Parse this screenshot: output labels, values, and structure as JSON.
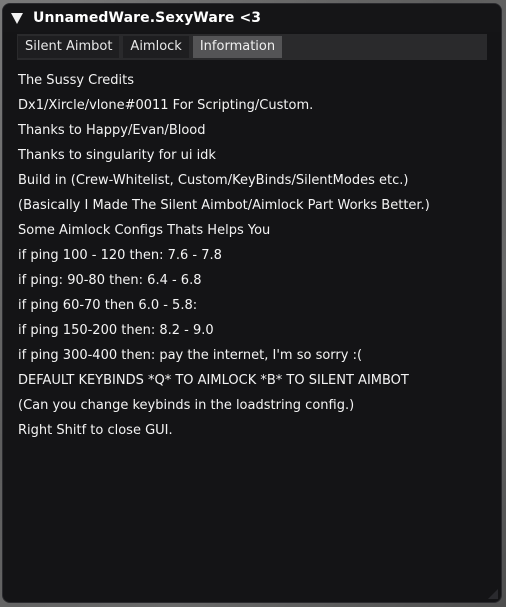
{
  "window": {
    "title": "UnnamedWare.SexyWare <3",
    "collapse_icon": "triangle-down-icon"
  },
  "tabs": [
    {
      "label": "Silent Aimbot",
      "active": false
    },
    {
      "label": "Aimlock",
      "active": false
    },
    {
      "label": "Information",
      "active": true
    }
  ],
  "info_lines": [
    "The Sussy Credits",
    "Dx1/Xircle/vlone#0011 For Scripting/Custom.",
    "Thanks to Happy/Evan/Blood",
    "Thanks to singularity for ui idk",
    "Build in (Crew-Whitelist, Custom/KeyBinds/SilentModes etc.)",
    "(Basically I Made The Silent Aimbot/Aimlock Part Works Better.)",
    "Some Aimlock Configs Thats Helps You",
    "if ping 100 - 120 then: 7.6 - 7.8",
    "if ping: 90-80 then: 6.4 - 6.8",
    "if ping 60-70 then 6.0 - 5.8:",
    "if ping 150-200 then: 8.2 - 9.0",
    "if ping 300-400 then: pay the internet, I'm so sorry :(",
    "DEFAULT KEYBINDS *Q* TO AIMLOCK *B* TO SILENT AIMBOT",
    "(Can you change keybinds in the loadstring config.)",
    "Right Shitf to close GUI."
  ],
  "colors": {
    "window_bg": "#141416",
    "tab_bg": "#1e1e20",
    "tab_active_bg": "#545456",
    "text": "#f4f4f4"
  }
}
